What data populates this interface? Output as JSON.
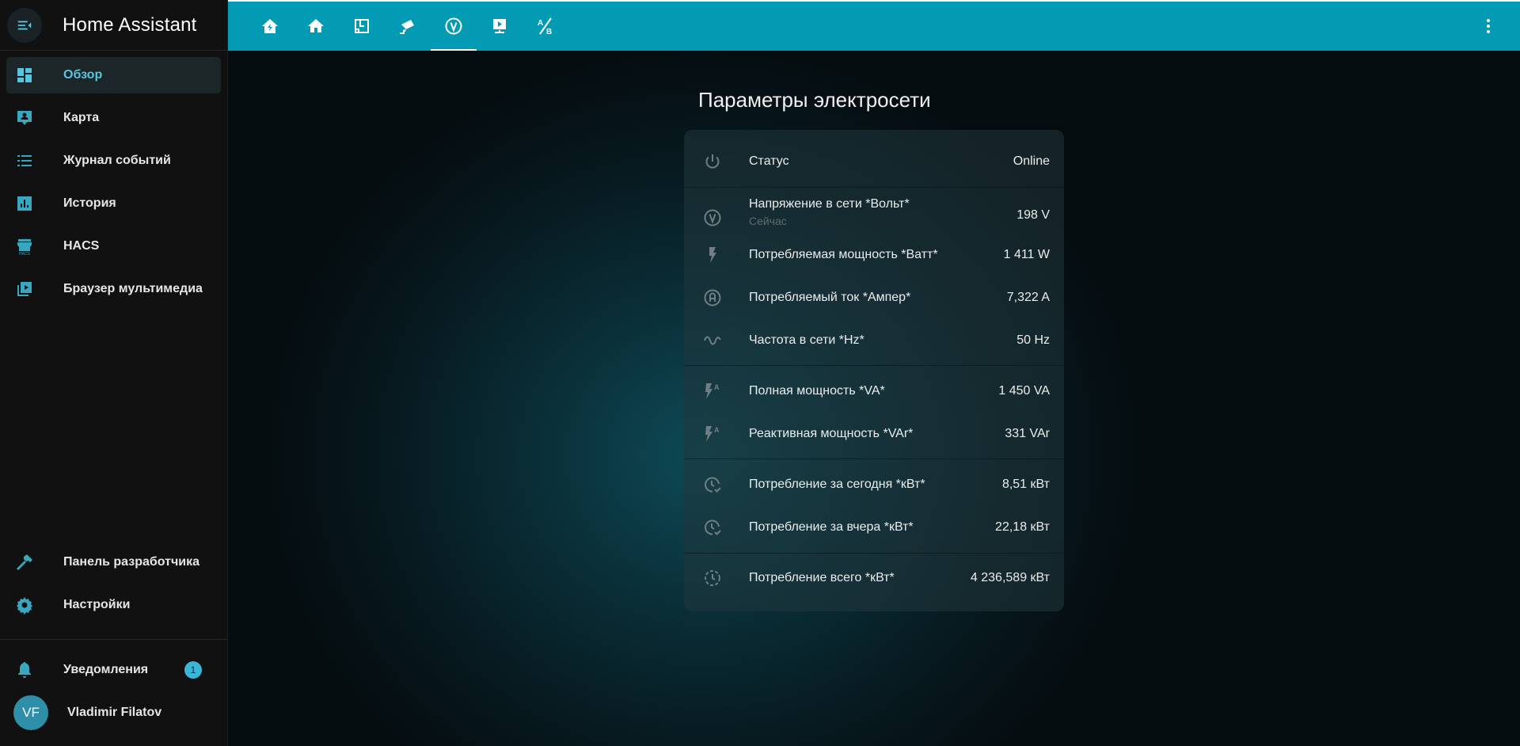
{
  "app": {
    "title": "Home Assistant"
  },
  "sidebar": {
    "items": [
      {
        "label": "Обзор",
        "icon": "dashboard-icon",
        "active": true
      },
      {
        "label": "Карта",
        "icon": "map-account-icon"
      },
      {
        "label": "Журнал событий",
        "icon": "logbook-list-icon"
      },
      {
        "label": "История",
        "icon": "history-chart-icon"
      },
      {
        "label": "HACS",
        "icon": "hacs-icon"
      },
      {
        "label": "Браузер мультимедиа",
        "icon": "media-browser-icon"
      }
    ],
    "bottom_items": [
      {
        "label": "Панель разработчика",
        "icon": "hammer-icon"
      },
      {
        "label": "Настройки",
        "icon": "gear-icon"
      }
    ],
    "notifications": {
      "label": "Уведомления",
      "count": "1",
      "icon": "bell-icon"
    },
    "user": {
      "name": "Vladimir Filatov",
      "initials": "VF"
    },
    "accent_color": "#56c6e0"
  },
  "topbar": {
    "color": "#039bb4",
    "tabs": [
      {
        "icon": "home-lightning-icon"
      },
      {
        "icon": "home-icon"
      },
      {
        "icon": "floor-plan-icon"
      },
      {
        "icon": "cctv-icon"
      },
      {
        "icon": "voltage-v-circle-icon",
        "active": true
      },
      {
        "icon": "monitor-play-icon"
      },
      {
        "icon": "ab-testing-icon"
      }
    ],
    "more_icon": "dots-vertical-icon"
  },
  "card": {
    "title": "Параметры электросети",
    "groups": [
      [
        {
          "name": "Статус",
          "value": "Online",
          "icon": "power-icon"
        }
      ],
      [
        {
          "name": "Напряжение в сети *Вольт*",
          "secondary": "Сейчас",
          "value": "198 V",
          "icon": "voltage-v-circle-icon"
        },
        {
          "name": "Потребляемая мощность *Ватт*",
          "value": "1 411 W",
          "icon": "flash-icon"
        },
        {
          "name": "Потребляемый ток *Ампер*",
          "value": "7,322 A",
          "icon": "current-a-circle-icon"
        },
        {
          "name": "Частота в сети *Hz*",
          "value": "50 Hz",
          "icon": "sine-wave-icon"
        }
      ],
      [
        {
          "name": "Полная мощность *VA*",
          "value": "1 450 VA",
          "icon": "flash-a-icon"
        },
        {
          "name": "Реактивная мощность *VAr*",
          "value": "331 VAr",
          "icon": "flash-a-icon"
        }
      ],
      [
        {
          "name": "Потребление за сегодня *кВт*",
          "value": "8,51 кВт",
          "icon": "clock-check-icon"
        },
        {
          "name": "Потребление за вчера *кВт*",
          "value": "22,18 кВт",
          "icon": "clock-check-icon"
        }
      ],
      [
        {
          "name": "Потребление всего *кВт*",
          "value": "4 236,589 кВт",
          "icon": "clock-dashed-icon"
        }
      ]
    ]
  }
}
